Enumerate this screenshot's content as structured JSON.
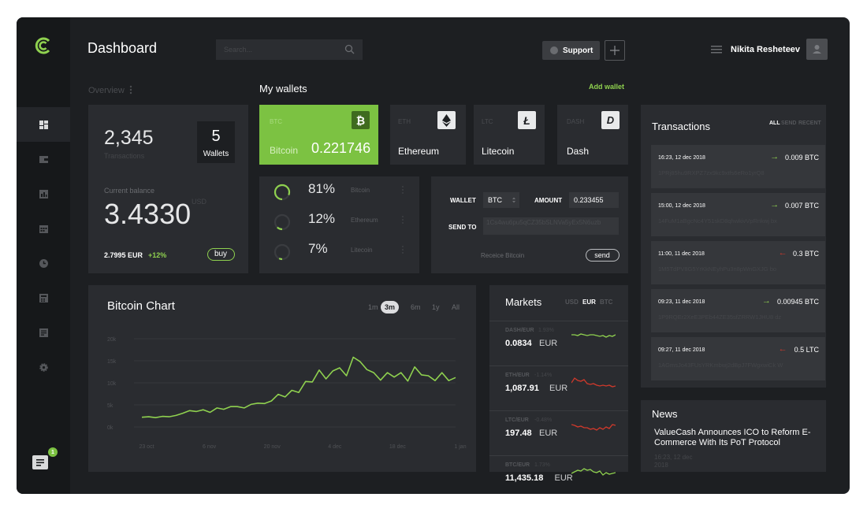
{
  "header": {
    "title": "Dashboard",
    "search_placeholder": "Search...",
    "support_label": "Support",
    "user_name": "Nikita Resheteev"
  },
  "overview": {
    "title": "Overview",
    "transactions_count": "2,345",
    "transactions_label": "Transactions",
    "wallets_count": "5",
    "wallets_label": "Wallets",
    "balance_label": "Current balance",
    "balance_value": "3.4330",
    "balance_currency": "USD",
    "eur_value": "2.7995 EUR",
    "eur_change": "+12%",
    "buy_label": "buy"
  },
  "wallets": {
    "title": "My wallets",
    "add_label": "Add wallet",
    "cards": [
      {
        "code": "BTC",
        "name": "Bitcoin",
        "amount": "0.221746",
        "icon": "bitcoin-icon"
      },
      {
        "code": "ETH",
        "name": "Ethereum",
        "icon": "ethereum-icon"
      },
      {
        "code": "LTC",
        "name": "Litecoin",
        "icon": "litecoin-icon"
      },
      {
        "code": "DASH",
        "name": "Dash",
        "icon": "dash-icon"
      }
    ]
  },
  "distribution": [
    {
      "percent": "81%",
      "name": "Bitcoin",
      "fraction": 0.81
    },
    {
      "percent": "12%",
      "name": "Ethereum",
      "fraction": 0.12
    },
    {
      "percent": "7%",
      "name": "Litecoin",
      "fraction": 0.07
    }
  ],
  "send_form": {
    "wallet_label": "WALLET",
    "wallet_value": "BTC",
    "amount_label": "AMOUNT",
    "amount_value": "0.233455",
    "send_to_label": "SEND TO",
    "send_to_value": "1Cs4wu6pu5qCZ35bSLNVa5yEx5N6uzb",
    "receive_label": "Receice Bitcoin",
    "send_label": "send"
  },
  "chart_data": {
    "type": "line",
    "title": "Bitcoin Chart",
    "ranges": [
      "1m",
      "3m",
      "6m",
      "1y",
      "All"
    ],
    "active_range": "3m",
    "y_ticks": [
      "20k",
      "15k",
      "10k",
      "5k",
      "0k"
    ],
    "x_ticks": [
      "23 oct",
      "6 nov",
      "20 nov",
      "4 dec",
      "18 dec",
      "1 jan"
    ],
    "ylim": [
      0,
      20000
    ],
    "grid": true,
    "series": [
      {
        "color": "#8fd14f",
        "values": [
          2200,
          2300,
          2100,
          2400,
          2300,
          2600,
          3100,
          3700,
          3500,
          3900,
          3300,
          4300,
          4000,
          4600,
          4600,
          4300,
          5100,
          5400,
          5300,
          5900,
          7400,
          6800,
          8300,
          7800,
          10300,
          10200,
          12900,
          10900,
          12700,
          13400,
          11600,
          15800,
          14800,
          13000,
          12300,
          10600,
          12300,
          11300,
          12300,
          10400,
          13600,
          11800,
          11600,
          10500,
          12300,
          10500,
          11200
        ]
      }
    ]
  },
  "markets": {
    "title": "Markets",
    "currencies": [
      "USD",
      "EUR",
      "BTC"
    ],
    "active_currency": "EUR",
    "rows": [
      {
        "pair": "DASH/EUR",
        "change": "1.93%",
        "value": "0.0834",
        "unit": "EUR",
        "trend": "up",
        "color": "#8fd14f"
      },
      {
        "pair": "ETH/EUR",
        "change": "-1.14%",
        "value": "1,087.91",
        "unit": "EUR",
        "trend": "down",
        "color": "#d0392b"
      },
      {
        "pair": "LTC/EUR",
        "change": "-0.48%",
        "value": "197.48",
        "unit": "EUR",
        "trend": "down",
        "color": "#d0392b"
      },
      {
        "pair": "BTC/EUR",
        "change": "1.73%",
        "value": "11,435.18",
        "unit": "EUR",
        "trend": "up",
        "color": "#8fd14f"
      }
    ]
  },
  "transactions": {
    "title": "Transactions",
    "tabs": [
      "ALL",
      "SEND",
      "RECENT"
    ],
    "active_tab": "ALL",
    "items": [
      {
        "time": "16:23, 12 dec 2018",
        "amount": "0.009 BTC",
        "direction": "in",
        "address": "1PRj85hu9RXPZ7zx9kc9xtfs6eRo1yrQ8"
      },
      {
        "time": "15:00, 12 dec 2018",
        "amount": "0.007 BTC",
        "direction": "in",
        "address": "14FuM1aBgcNc4Y51skD8qhwkivVpRnkwj bx"
      },
      {
        "time": "11:00, 11 dec 2018",
        "amount": "0.3 BTC",
        "direction": "out",
        "address": "1M5TdPV8G5YrKkNEyhPu3n8pWnGXJG bo"
      },
      {
        "time": "09:23, 11 dec 2018",
        "amount": "0.00945 BTC",
        "direction": "in",
        "address": "1P9RQEr2XeE3PEb44ZE35sfZRRW1JHU8 dz"
      },
      {
        "time": "09:27, 11 dec 2018",
        "amount": "0.5 LTC",
        "direction": "out",
        "address": "1AGmsJo43FUsYRKmbwj2dBpJ7FWgxwiCk W"
      }
    ]
  },
  "news": {
    "title": "News",
    "headline": "ValueCash Announces ICO to Reform E-Commerce With Its PoT Protocol",
    "time": "16:23, 12 dec 2018"
  },
  "sidebar": {
    "items": [
      "dashboard-icon",
      "wallet-icon",
      "chart-icon",
      "calendar-icon",
      "clock-icon",
      "calculator-icon",
      "document-icon",
      "settings-icon"
    ],
    "chat_badge": "1"
  }
}
